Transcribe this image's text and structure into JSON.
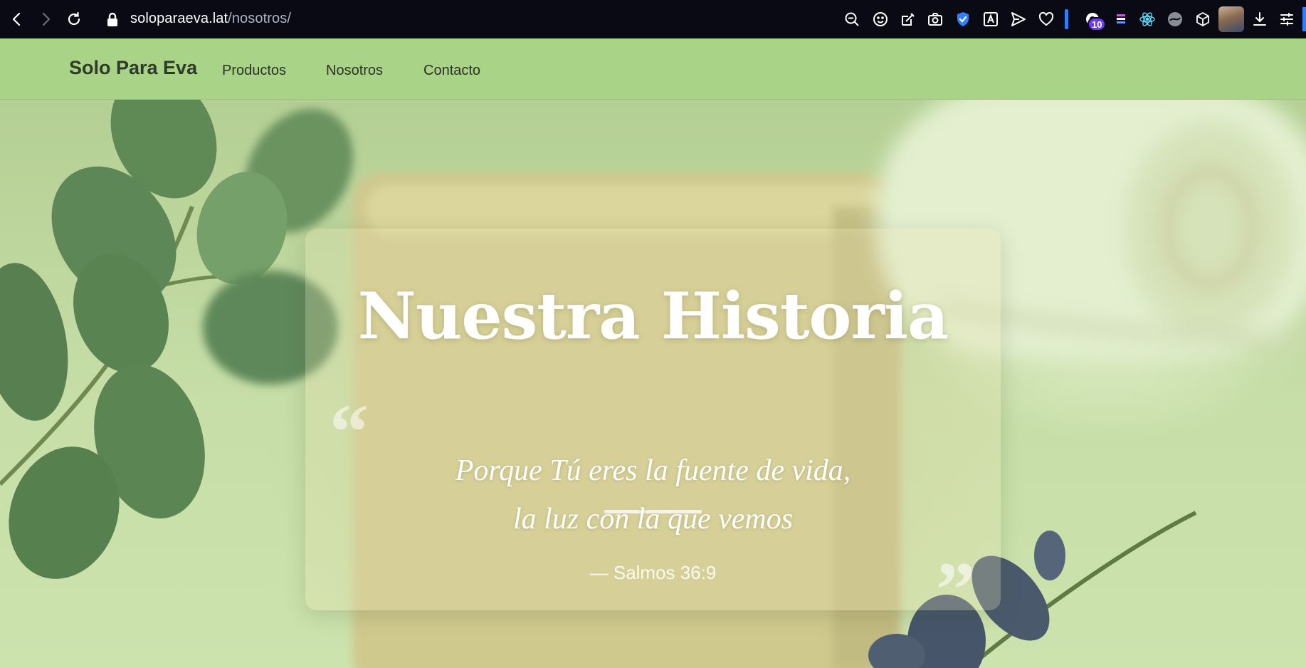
{
  "browser": {
    "url_host": "soloparaeva.lat",
    "url_path": "/nosotros/",
    "extension_badge": "10"
  },
  "header": {
    "brand": "Solo Para Eva",
    "nav": [
      {
        "label": "Productos"
      },
      {
        "label": "Nosotros"
      },
      {
        "label": "Contacto"
      }
    ]
  },
  "hero": {
    "title": "Nuestra Historia",
    "quote_open": "“",
    "quote_close": "”",
    "quote_lines": [
      "Porque Tú eres la fuente de vida,",
      "la luz con la que vemos"
    ],
    "citation": "— Salmos 36:9"
  },
  "colors": {
    "header_bg": "#a9d386",
    "browser_bg": "#090a14",
    "accent_blue": "#2f80ff",
    "text_dark": "#2e3a2a"
  }
}
